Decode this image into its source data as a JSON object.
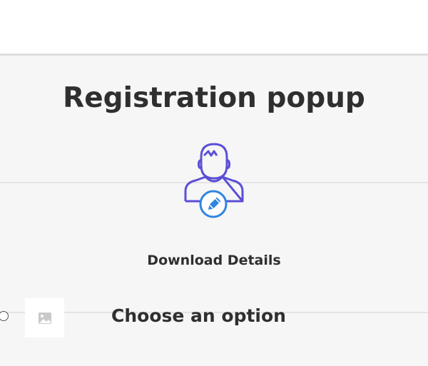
{
  "popup": {
    "title": "Registration popup",
    "details_label": "Download Details",
    "option_heading": "Choose an option"
  },
  "icons": {
    "user": "user-edit-icon",
    "placeholder": "image-placeholder-icon",
    "radio": "radio-button"
  },
  "colors": {
    "icon_outline": "#5b4fd6",
    "edit_badge": "#2f86df",
    "panel_background": "#f6f6f6",
    "text": "#2f2f2f"
  }
}
